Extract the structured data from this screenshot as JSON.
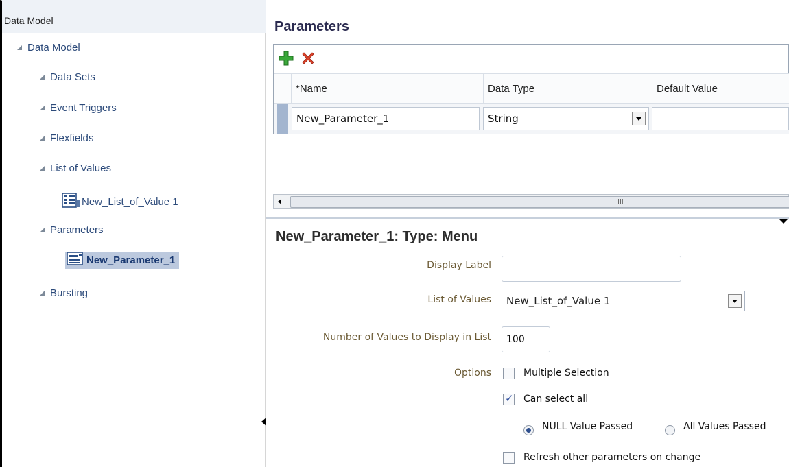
{
  "tree": {
    "header": "Data Model",
    "root": "Data Model",
    "items": [
      {
        "label": "Data Sets"
      },
      {
        "label": "Event Triggers"
      },
      {
        "label": "Flexfields"
      },
      {
        "label": "List of Values"
      },
      {
        "label": "New_List_of_Value 1",
        "icon": "list-of-values-icon"
      },
      {
        "label": "Parameters"
      },
      {
        "label": "New_Parameter_1",
        "icon": "parameter-icon",
        "selected": true
      },
      {
        "label": "Bursting"
      }
    ]
  },
  "parameters": {
    "title": "Parameters",
    "toolbar": {
      "add": "add-icon",
      "delete": "delete-icon"
    },
    "columns": [
      "*Name",
      "Data Type",
      "Default Value"
    ],
    "row": {
      "name": "New_Parameter_1",
      "data_type": "String",
      "default_value": ""
    },
    "scroll_grip": "III"
  },
  "detail": {
    "title": "New_Parameter_1: Type: Menu",
    "display_label": {
      "label": "Display Label",
      "value": ""
    },
    "list_of_values": {
      "label": "List of Values",
      "value": "New_List_of_Value 1"
    },
    "num_values": {
      "label": "Number of Values to Display in List",
      "value": "100"
    },
    "options": {
      "label": "Options",
      "multiple_selection": {
        "label": "Multiple Selection",
        "checked": false
      },
      "can_select_all": {
        "label": "Can select all",
        "checked": true
      },
      "null_value_passed": {
        "label": "NULL Value Passed",
        "selected": true
      },
      "all_values_passed": {
        "label": "All Values Passed",
        "selected": false
      },
      "refresh": {
        "label": "Refresh other parameters on change",
        "checked": false
      }
    }
  },
  "colors": {
    "selected_row": "#bcc9de",
    "tree_text": "#2c4a7a",
    "label_text": "#6b5a34"
  }
}
